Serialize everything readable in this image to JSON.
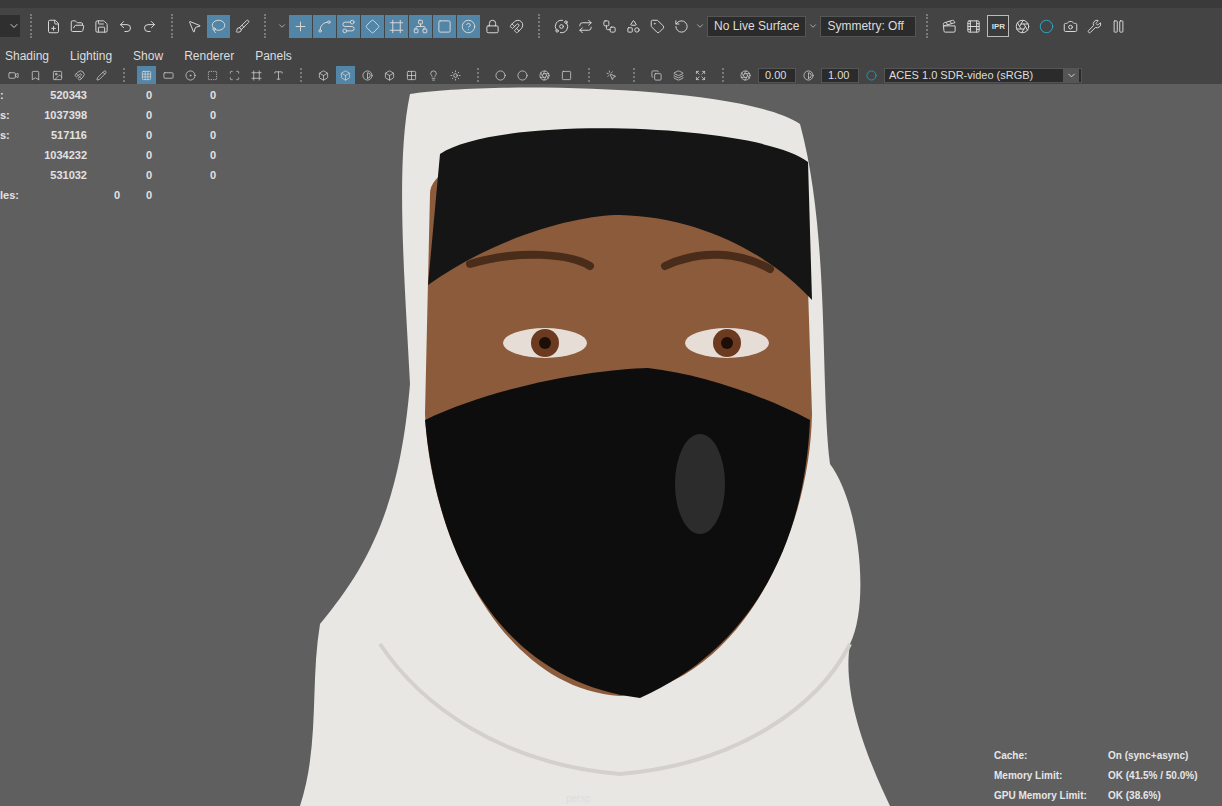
{
  "top_toolbar": [
    {
      "kind": "menu-box"
    },
    {
      "kind": "separator"
    },
    {
      "kind": "icon",
      "selected": false
    },
    {
      "kind": "icon",
      "selected": false
    },
    {
      "kind": "icon",
      "selected": false
    },
    {
      "kind": "icon",
      "selected": false
    },
    {
      "kind": "icon",
      "selected": false
    },
    {
      "kind": "separator"
    },
    {
      "kind": "icon",
      "selected": false
    },
    {
      "kind": "icon",
      "selected": true
    },
    {
      "kind": "icon",
      "selected": false
    },
    {
      "kind": "separator"
    },
    {
      "kind": "arrow"
    },
    {
      "kind": "icon",
      "selected": true
    },
    {
      "kind": "icon",
      "selected": true
    },
    {
      "kind": "icon",
      "selected": true
    },
    {
      "kind": "icon",
      "selected": true
    },
    {
      "kind": "icon",
      "selected": true
    },
    {
      "kind": "icon",
      "selected": true
    },
    {
      "kind": "icon",
      "selected": true
    },
    {
      "kind": "icon",
      "selected": true
    },
    {
      "kind": "icon",
      "selected": false
    },
    {
      "kind": "icon",
      "selected": false
    },
    {
      "kind": "separator"
    },
    {
      "kind": "icon",
      "selected": false
    },
    {
      "kind": "icon",
      "selected": false
    },
    {
      "kind": "icon",
      "selected": false
    },
    {
      "kind": "icon",
      "selected": false
    },
    {
      "kind": "icon",
      "selected": false
    },
    {
      "kind": "icon",
      "selected": false
    },
    {
      "kind": "arrow"
    },
    {
      "kind": "field",
      "text": "No Live Surface"
    },
    {
      "kind": "arrow"
    },
    {
      "kind": "field",
      "text": "Symmetry: Off"
    },
    {
      "kind": "separator"
    },
    {
      "kind": "icon",
      "selected": false
    },
    {
      "kind": "icon",
      "selected": false
    },
    {
      "kind": "text-icon",
      "text": "IPR"
    },
    {
      "kind": "icon",
      "selected": false
    },
    {
      "kind": "icon",
      "selected": false
    },
    {
      "kind": "icon",
      "selected": false
    },
    {
      "kind": "icon",
      "selected": false
    },
    {
      "kind": "icon",
      "selected": false
    }
  ],
  "menu": [
    "Shading",
    "Lighting",
    "Show",
    "Renderer",
    "Panels"
  ],
  "panel_toolbar": [
    {
      "kind": "icon",
      "selected": false
    },
    {
      "kind": "icon",
      "selected": false
    },
    {
      "kind": "icon",
      "selected": false
    },
    {
      "kind": "icon",
      "selected": false
    },
    {
      "kind": "icon",
      "selected": false
    },
    {
      "kind": "separator"
    },
    {
      "kind": "icon",
      "selected": true
    },
    {
      "kind": "icon",
      "selected": false
    },
    {
      "kind": "icon",
      "selected": false
    },
    {
      "kind": "icon",
      "selected": false
    },
    {
      "kind": "icon",
      "selected": false
    },
    {
      "kind": "icon",
      "selected": false
    },
    {
      "kind": "icon",
      "selected": false
    },
    {
      "kind": "separator"
    },
    {
      "kind": "icon",
      "selected": false
    },
    {
      "kind": "icon",
      "selected": true
    },
    {
      "kind": "icon",
      "selected": false
    },
    {
      "kind": "icon",
      "selected": false
    },
    {
      "kind": "icon",
      "selected": false
    },
    {
      "kind": "icon",
      "selected": false
    },
    {
      "kind": "icon",
      "selected": false
    },
    {
      "kind": "separator"
    },
    {
      "kind": "icon",
      "selected": false
    },
    {
      "kind": "icon",
      "selected": false
    },
    {
      "kind": "icon",
      "selected": false
    },
    {
      "kind": "icon",
      "selected": false
    },
    {
      "kind": "separator"
    },
    {
      "kind": "icon",
      "selected": false
    },
    {
      "kind": "separator"
    },
    {
      "kind": "icon",
      "selected": false
    },
    {
      "kind": "icon",
      "selected": false
    },
    {
      "kind": "icon",
      "selected": false
    },
    {
      "kind": "separator"
    },
    {
      "kind": "icon",
      "selected": false
    },
    {
      "kind": "field",
      "text": "0.00"
    },
    {
      "kind": "icon",
      "selected": false
    },
    {
      "kind": "field",
      "text": "1.00"
    },
    {
      "kind": "icon",
      "selected": false
    },
    {
      "kind": "dropdown",
      "text": "ACES 1.0 SDR-video (sRGB)"
    }
  ],
  "viewport": {
    "camera": "persp",
    "stats": [
      {
        "label": ":",
        "values": [
          "520343",
          "0",
          "0"
        ]
      },
      {
        "label": "s:",
        "values": [
          "1037398",
          "0",
          "0"
        ]
      },
      {
        "label": "s:",
        "values": [
          "517116",
          "0",
          "0"
        ]
      },
      {
        "label": "",
        "values": [
          "1034232",
          "0",
          "0"
        ]
      },
      {
        "label": "",
        "values": [
          "531032",
          "0",
          "0"
        ]
      },
      {
        "label": "les:",
        "values": [
          "0",
          "0"
        ]
      }
    ],
    "hud": [
      {
        "label": "Cache:",
        "value": "On (sync+async)"
      },
      {
        "label": "Memory Limit:",
        "value": "OK (41.5% / 50.0%)"
      },
      {
        "label": "GPU Memory Limit:",
        "value": "OK (38.6%)"
      }
    ]
  }
}
